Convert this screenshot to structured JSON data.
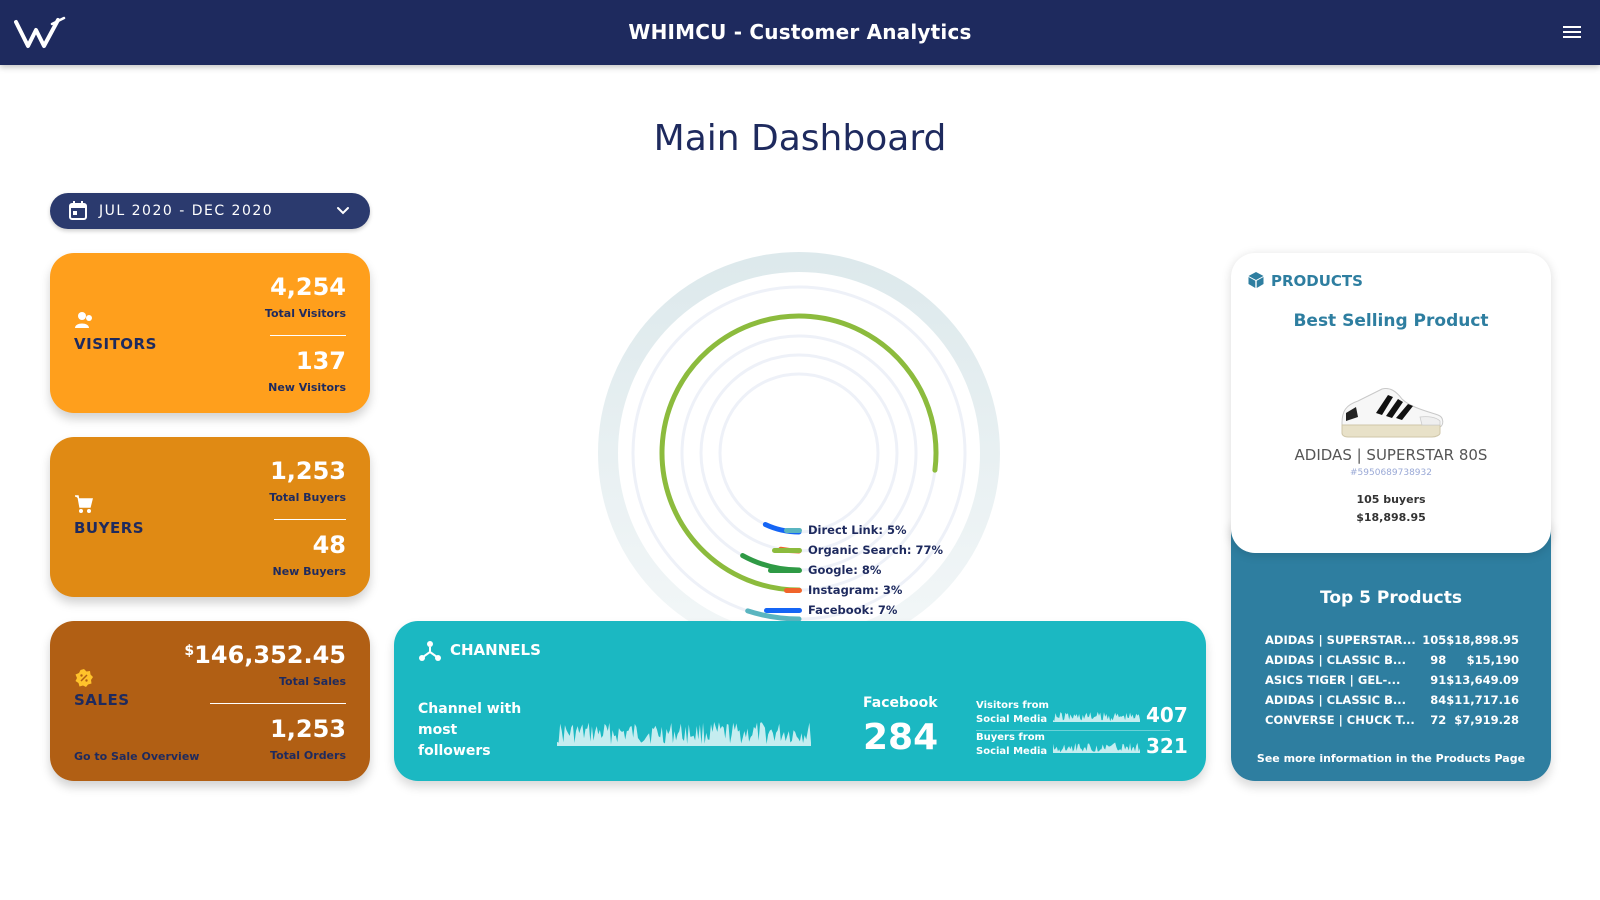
{
  "header": {
    "title": "WHIMCU - Customer Analytics",
    "logo_icon": "whimcu-logo",
    "menu_icon": "hamburger-menu-icon"
  },
  "page": {
    "title": "Main Dashboard"
  },
  "date_range": {
    "label": "JUL 2020 - DEC 2020"
  },
  "visitors": {
    "label": "VISITORS",
    "total_value": "4,254",
    "total_label": "Total Visitors",
    "new_value": "137",
    "new_label": "New Visitors",
    "color": "#ff9f1c"
  },
  "buyers": {
    "label": "BUYERS",
    "total_value": "1,253",
    "total_label": "Total Buyers",
    "new_value": "48",
    "new_label": "New Buyers",
    "color": "#e08a14"
  },
  "sales": {
    "label": "SALES",
    "currency": "$",
    "total_value": "146,352.45",
    "total_label": "Total Sales",
    "orders_value": "1,253",
    "orders_label": "Total Orders",
    "link": "Go to Sale Overview",
    "color": "#b15f14"
  },
  "chart_data": {
    "type": "pie",
    "title": "",
    "series": [
      {
        "name": "Direct Link",
        "value": 5,
        "label": "Direct Link: 5%",
        "color": "#5ab5c0"
      },
      {
        "name": "Organic Search",
        "value": 77,
        "label": "Organic Search: 77%",
        "color": "#8cbb3d"
      },
      {
        "name": "Google",
        "value": 8,
        "label": "Google: 8%",
        "color": "#2f9a45"
      },
      {
        "name": "Instagram",
        "value": 3,
        "label": "Instagram: 3%",
        "color": "#f0642a"
      },
      {
        "name": "Facebook",
        "value": 7,
        "label": "Facebook: 7%",
        "color": "#1565f5"
      }
    ]
  },
  "channels": {
    "title": "CHANNELS",
    "most_followers_label": "Channel with most followers",
    "top_channel_name": "Facebook",
    "top_channel_value": "284",
    "visitors_label": "Visitors from Social Media",
    "visitors_value": "407",
    "buyers_label": "Buyers from Social Media",
    "buyers_value": "321",
    "color": "#1bb8c2"
  },
  "products": {
    "title": "PRODUCTS",
    "best_label": "Best Selling Product",
    "best_name": "ADIDAS | SUPERSTAR 80S",
    "best_sku": "#5950689738932",
    "best_buyers": "105 buyers",
    "best_sales": "$18,898.95",
    "top5_title": "Top 5 Products",
    "top5": [
      {
        "name": "ADIDAS | SUPERSTAR...",
        "count": "105",
        "sales": "$18,898.95"
      },
      {
        "name": "ADIDAS | CLASSIC B...",
        "count": "98",
        "sales": "$15,190"
      },
      {
        "name": "ASICS TIGER | GEL-...",
        "count": "91",
        "sales": "$13,649.09"
      },
      {
        "name": "ADIDAS | CLASSIC B...",
        "count": "84",
        "sales": "$11,717.16"
      },
      {
        "name": "CONVERSE | CHUCK T...",
        "count": "72",
        "sales": "$7,919.28"
      }
    ],
    "more_link": "See more information in the Products Page",
    "color": "#2e7ea0"
  }
}
